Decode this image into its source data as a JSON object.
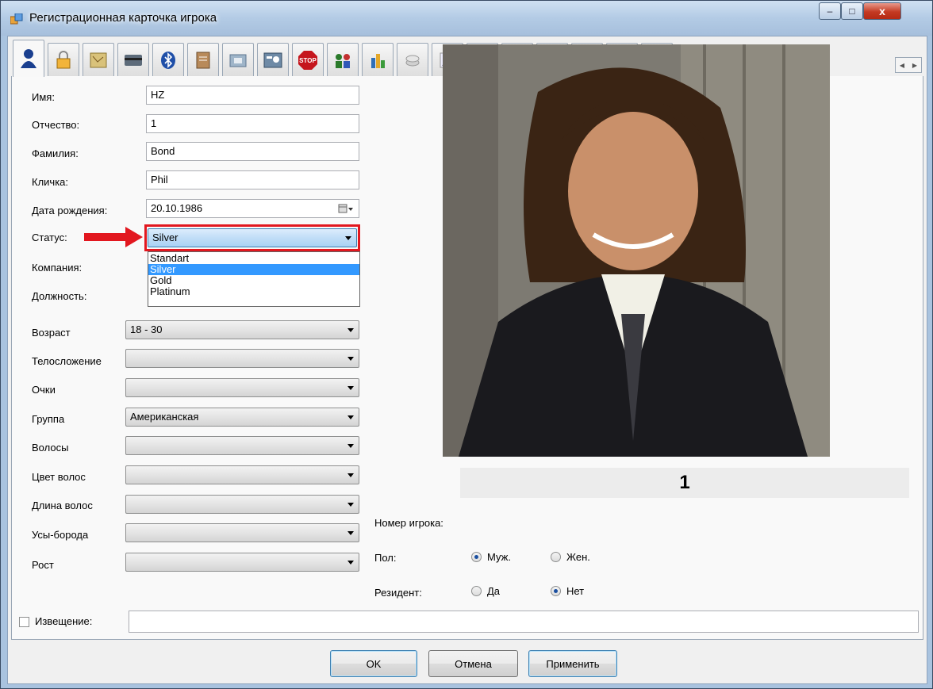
{
  "window": {
    "title": "Регистрационная карточка игрока",
    "minimize": "–",
    "maximize": "□",
    "close": "x"
  },
  "tabs": [
    {
      "icon": "user-icon",
      "active": true
    },
    {
      "icon": "lock-icon"
    },
    {
      "icon": "map-icon"
    },
    {
      "icon": "card-icon"
    },
    {
      "icon": "bluetooth-icon"
    },
    {
      "icon": "document-icon"
    },
    {
      "icon": "folder-icon"
    },
    {
      "icon": "id-card-icon"
    },
    {
      "icon": "stop-icon"
    },
    {
      "icon": "people-icon"
    },
    {
      "icon": "chart-icon"
    },
    {
      "icon": "coins-icon"
    },
    {
      "icon": "pen-icon"
    },
    {
      "icon": "car-icon"
    },
    {
      "icon": "calculator-icon"
    },
    {
      "icon": "burger-icon"
    },
    {
      "icon": "money-bag-icon"
    },
    {
      "icon": "book-icon"
    },
    {
      "icon": "clock-money-icon"
    }
  ],
  "form": {
    "name_label": "Имя:",
    "name_value": "HZ",
    "patronymic_label": "Отчество:",
    "patronymic_value": "1",
    "surname_label": "Фамилия:",
    "surname_value": "Bond",
    "nickname_label": "Кличка:",
    "nickname_value": "Phil",
    "birthdate_label": "Дата рождения:",
    "birthdate_value": "20.10.1986",
    "status_label": "Статус:",
    "status_value": "Silver",
    "status_options": [
      "Standart",
      "Silver",
      "Gold",
      "Platinum"
    ],
    "company_label": "Компания:",
    "position_label": "Должность:",
    "age_label": "Возраст",
    "age_value": "18 - 30",
    "build_label": "Телосложение",
    "build_value": "",
    "glasses_label": "Очки",
    "glasses_value": "",
    "group_label": "Группа",
    "group_value": "Американская",
    "hair_label": "Волосы",
    "hair_value": "",
    "hair_color_label": "Цвет волос",
    "hair_color_value": "",
    "hair_length_label": "Длина волос",
    "hair_length_value": "",
    "beard_label": "Усы-борода",
    "beard_value": "",
    "height_label": "Рост",
    "height_value": "",
    "player_number_label": "Номер игрока:",
    "player_number_value": "1",
    "gender_label": "Пол:",
    "gender_male": "Муж.",
    "gender_female": "Жен.",
    "gender_selected": "male",
    "resident_label": "Резидент:",
    "resident_yes": "Да",
    "resident_no": "Нет",
    "resident_selected": "no",
    "notice_label": "Извещение:",
    "notice_value": ""
  },
  "buttons": {
    "ok": "OK",
    "cancel": "Отмена",
    "apply": "Применить"
  },
  "colors": {
    "highlight": "#e2171f",
    "selection": "#3399ff"
  }
}
